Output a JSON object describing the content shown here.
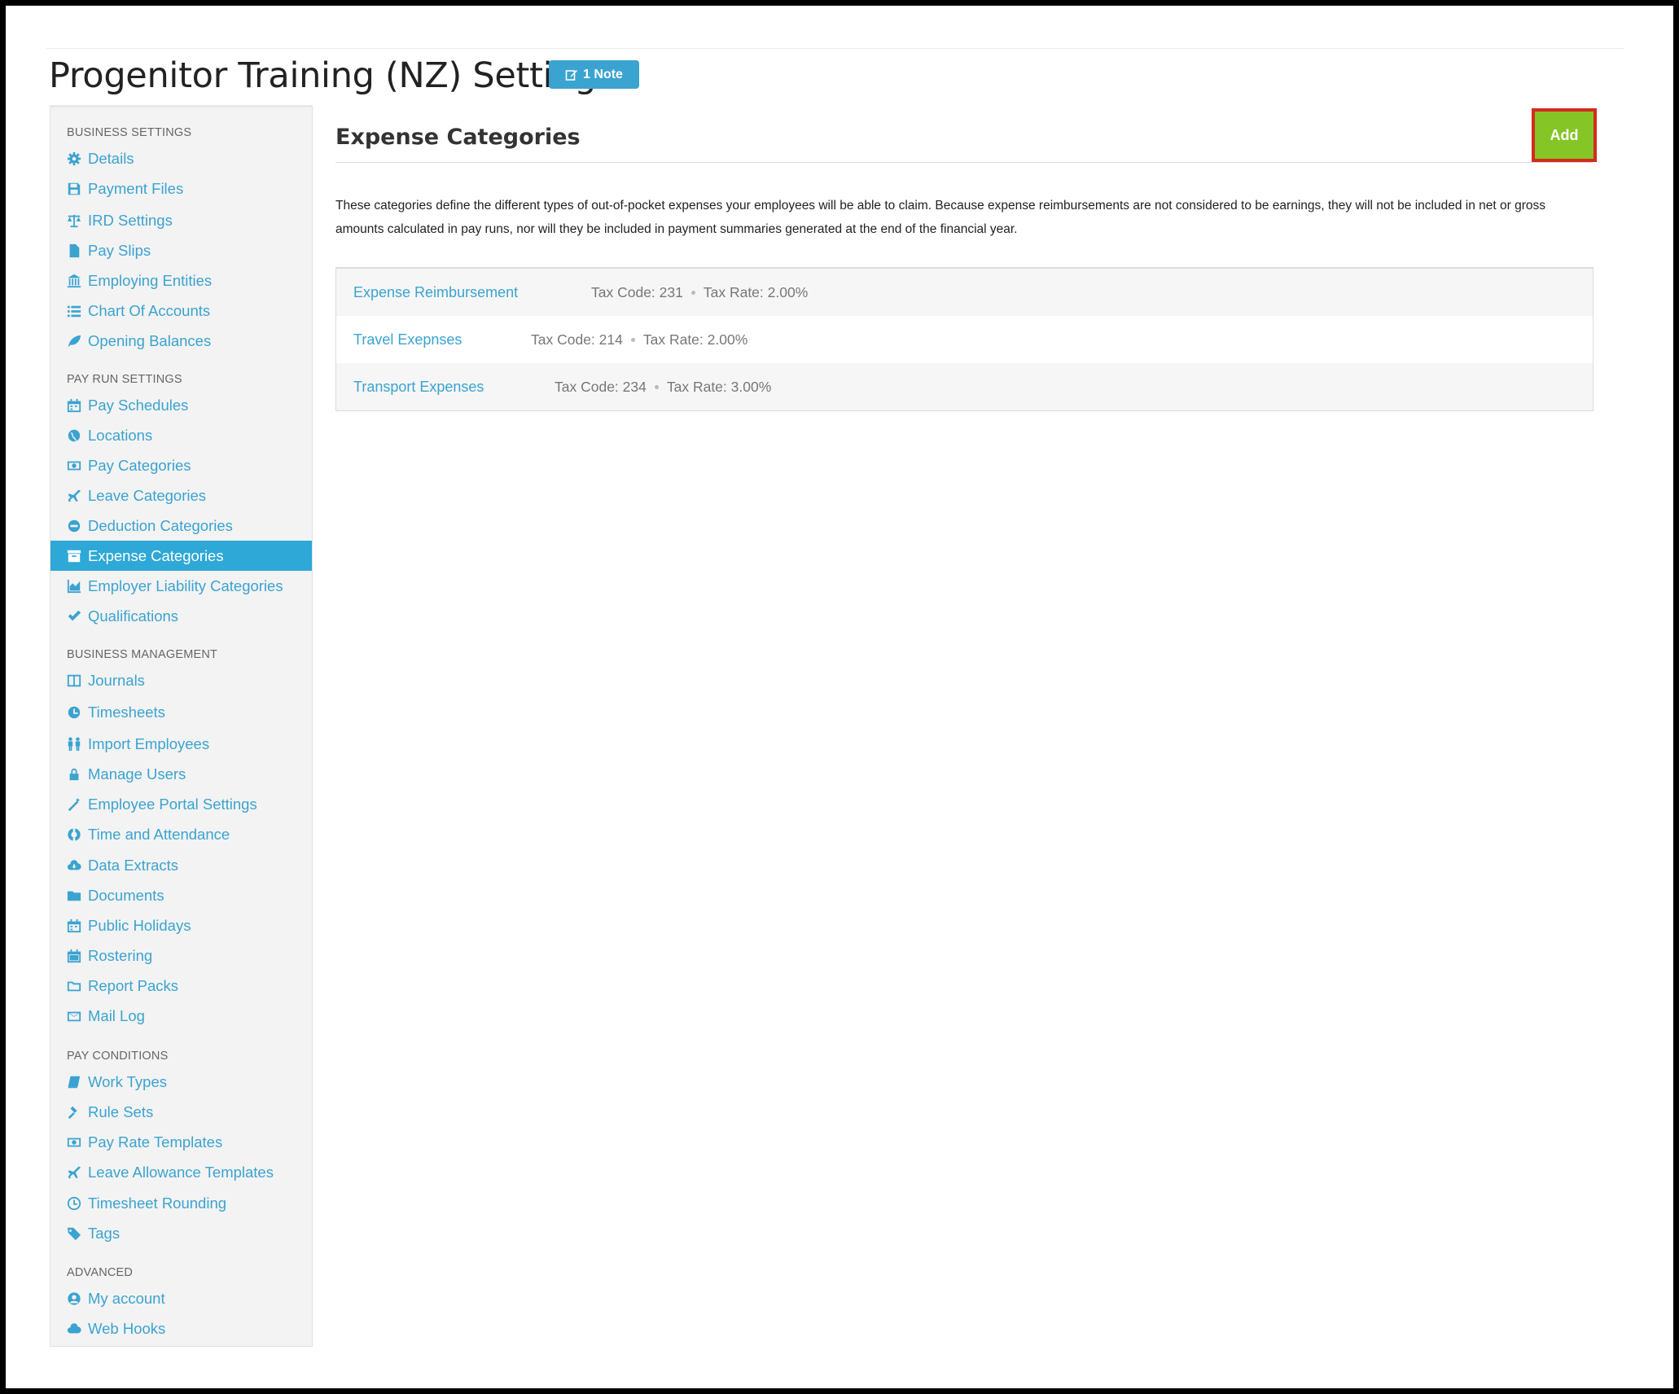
{
  "page": {
    "title": "Progenitor Training (NZ) Settings",
    "note_badge": "1 Note"
  },
  "sidebar": {
    "sections": [
      {
        "title": "BUSINESS SETTINGS",
        "items": [
          {
            "label": "Details",
            "icon": "gear-icon"
          },
          {
            "label": "Payment Files",
            "icon": "floppy-icon"
          },
          {
            "label": "IRD Settings",
            "icon": "scale-icon"
          },
          {
            "label": "Pay Slips",
            "icon": "file-icon"
          },
          {
            "label": "Employing Entities",
            "icon": "bank-icon"
          },
          {
            "label": "Chart Of Accounts",
            "icon": "list-icon"
          },
          {
            "label": "Opening Balances",
            "icon": "leaf-icon"
          }
        ]
      },
      {
        "title": "PAY RUN SETTINGS",
        "items": [
          {
            "label": "Pay Schedules",
            "icon": "calendar-icon"
          },
          {
            "label": "Locations",
            "icon": "globe-icon"
          },
          {
            "label": "Pay Categories",
            "icon": "money-icon"
          },
          {
            "label": "Leave Categories",
            "icon": "plane-icon"
          },
          {
            "label": "Deduction Categories",
            "icon": "minus-circle-icon"
          },
          {
            "label": "Expense Categories",
            "icon": "archive-icon",
            "active": true
          },
          {
            "label": "Employer Liability Categories",
            "icon": "chart-icon"
          },
          {
            "label": "Qualifications",
            "icon": "check-icon"
          }
        ]
      },
      {
        "title": "BUSINESS MANAGEMENT",
        "items": [
          {
            "label": "Journals",
            "icon": "columns-icon"
          },
          {
            "label": "Timesheets",
            "icon": "clock-icon"
          },
          {
            "label": "Import Employees",
            "icon": "users-icon"
          },
          {
            "label": "Manage Users",
            "icon": "lock-icon"
          },
          {
            "label": "Employee Portal Settings",
            "icon": "wand-icon"
          },
          {
            "label": "Time and Attendance",
            "icon": "lifebuoy-icon"
          },
          {
            "label": "Data Extracts",
            "icon": "cloud-download-icon"
          },
          {
            "label": "Documents",
            "icon": "folder-icon"
          },
          {
            "label": "Public Holidays",
            "icon": "calendar-icon"
          },
          {
            "label": "Rostering",
            "icon": "calendar-grid-icon"
          },
          {
            "label": "Report Packs",
            "icon": "folder-outline-icon"
          },
          {
            "label": "Mail Log",
            "icon": "envelope-icon"
          }
        ]
      },
      {
        "title": "PAY CONDITIONS",
        "items": [
          {
            "label": "Work Types",
            "icon": "book-icon"
          },
          {
            "label": "Rule Sets",
            "icon": "gavel-icon"
          },
          {
            "label": "Pay Rate Templates",
            "icon": "money-icon"
          },
          {
            "label": "Leave Allowance Templates",
            "icon": "plane-icon"
          },
          {
            "label": "Timesheet Rounding",
            "icon": "clock-outline-icon"
          },
          {
            "label": "Tags",
            "icon": "tag-icon"
          }
        ]
      },
      {
        "title": "ADVANCED",
        "items": [
          {
            "label": "My account",
            "icon": "user-circle-icon"
          },
          {
            "label": "Web Hooks",
            "icon": "cloud-icon"
          }
        ]
      }
    ]
  },
  "main": {
    "heading": "Expense Categories",
    "add_label": "Add",
    "description": "These categories define the different types of out-of-pocket expenses your employees will be able to claim. Because expense reimbursements are not considered to be earnings, they will not be included in net or gross amounts calculated in pay runs, nor will they be included in payment summaries generated at the end of the financial year.",
    "rows": [
      {
        "name": "Expense Reimbursement",
        "tax_code": "Tax Code: 231",
        "tax_rate": "Tax Rate: 2.00%"
      },
      {
        "name": "Travel Exepnses",
        "tax_code": "Tax Code: 214",
        "tax_rate": "Tax Rate: 2.00%"
      },
      {
        "name": "Transport Expenses",
        "tax_code": "Tax Code: 234",
        "tax_rate": "Tax Rate: 3.00%"
      }
    ]
  },
  "colors": {
    "accent": "#3ba3d0",
    "active_bg": "#2ea8d6",
    "add_button": "#85c526",
    "highlight_border": "#d42b1e"
  }
}
